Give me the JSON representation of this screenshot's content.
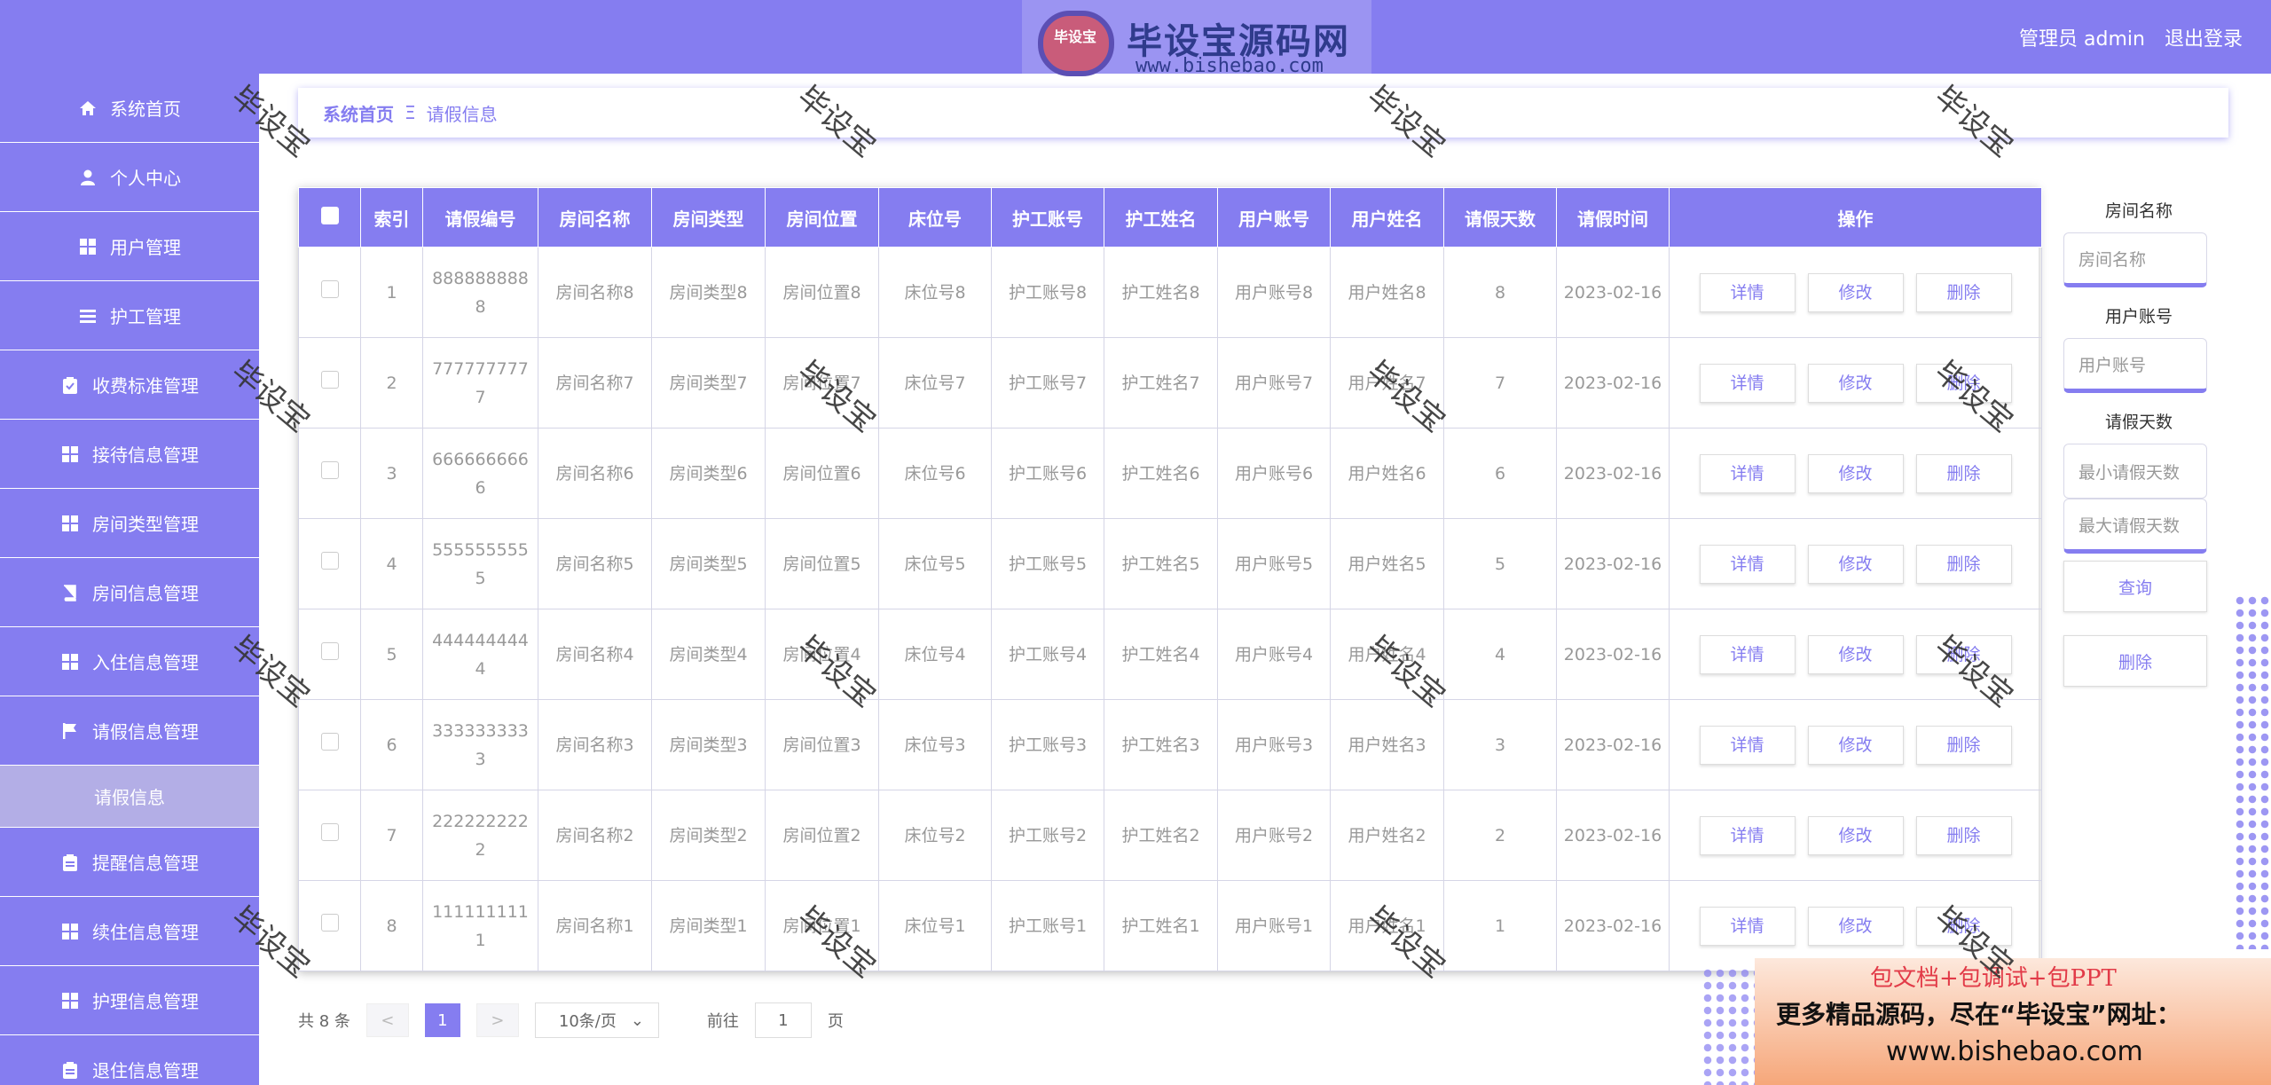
{
  "header": {
    "user_label": "管理员 admin",
    "logout": "退出登录",
    "brand_logo_text": "毕设宝",
    "brand_title": "毕设宝源码网",
    "brand_url": "www.bishebao.com"
  },
  "sidebar": {
    "items": [
      {
        "label": "系统首页",
        "icon": "home-icon"
      },
      {
        "label": "个人中心",
        "icon": "user-icon"
      },
      {
        "label": "用户管理",
        "icon": "grid-icon"
      },
      {
        "label": "护工管理",
        "icon": "list-icon"
      },
      {
        "label": "收费标准管理",
        "icon": "clipboard-check-icon"
      },
      {
        "label": "接待信息管理",
        "icon": "grid-icon"
      },
      {
        "label": "房间类型管理",
        "icon": "grid-icon"
      },
      {
        "label": "房间信息管理",
        "icon": "book-icon"
      },
      {
        "label": "入住信息管理",
        "icon": "grid-icon"
      },
      {
        "label": "请假信息管理",
        "icon": "flag-icon"
      }
    ],
    "active_sub": "请假信息",
    "items_after": [
      {
        "label": "提醒信息管理",
        "icon": "clipboard-icon"
      },
      {
        "label": "续住信息管理",
        "icon": "grid-icon"
      },
      {
        "label": "护理信息管理",
        "icon": "grid-icon"
      },
      {
        "label": "退住信息管理",
        "icon": "clipboard-icon"
      }
    ]
  },
  "breadcrumb": {
    "home": "系统首页",
    "sep": "Ξ",
    "current": "请假信息"
  },
  "table": {
    "headers": [
      "索引",
      "请假编号",
      "房间名称",
      "房间类型",
      "房间位置",
      "床位号",
      "护工账号",
      "护工姓名",
      "用户账号",
      "用户姓名",
      "请假天数",
      "请假时间",
      "操作"
    ],
    "rows": [
      [
        "1",
        "8888888888",
        "房间名称8",
        "房间类型8",
        "房间位置8",
        "床位号8",
        "护工账号8",
        "护工姓名8",
        "用户账号8",
        "用户姓名8",
        "8",
        "2023-02-16"
      ],
      [
        "2",
        "7777777777",
        "房间名称7",
        "房间类型7",
        "房间位置7",
        "床位号7",
        "护工账号7",
        "护工姓名7",
        "用户账号7",
        "用户姓名7",
        "7",
        "2023-02-16"
      ],
      [
        "3",
        "6666666666",
        "房间名称6",
        "房间类型6",
        "房间位置6",
        "床位号6",
        "护工账号6",
        "护工姓名6",
        "用户账号6",
        "用户姓名6",
        "6",
        "2023-02-16"
      ],
      [
        "4",
        "5555555555",
        "房间名称5",
        "房间类型5",
        "房间位置5",
        "床位号5",
        "护工账号5",
        "护工姓名5",
        "用户账号5",
        "用户姓名5",
        "5",
        "2023-02-16"
      ],
      [
        "5",
        "4444444444",
        "房间名称4",
        "房间类型4",
        "房间位置4",
        "床位号4",
        "护工账号4",
        "护工姓名4",
        "用户账号4",
        "用户姓名4",
        "4",
        "2023-02-16"
      ],
      [
        "6",
        "3333333333",
        "房间名称3",
        "房间类型3",
        "房间位置3",
        "床位号3",
        "护工账号3",
        "护工姓名3",
        "用户账号3",
        "用户姓名3",
        "3",
        "2023-02-16"
      ],
      [
        "7",
        "2222222222",
        "房间名称2",
        "房间类型2",
        "房间位置2",
        "床位号2",
        "护工账号2",
        "护工姓名2",
        "用户账号2",
        "用户姓名2",
        "2",
        "2023-02-16"
      ],
      [
        "8",
        "1111111111",
        "房间名称1",
        "房间类型1",
        "房间位置1",
        "床位号1",
        "护工账号1",
        "护工姓名1",
        "用户账号1",
        "用户姓名1",
        "1",
        "2023-02-16"
      ]
    ],
    "actions": {
      "detail": "详情",
      "edit": "修改",
      "delete": "删除"
    }
  },
  "search": {
    "room_label": "房间名称",
    "room_placeholder": "房间名称",
    "user_label": "用户账号",
    "user_placeholder": "用户账号",
    "days_label": "请假天数",
    "days_min_placeholder": "最小请假天数",
    "days_max_placeholder": "最大请假天数",
    "query_btn": "查询",
    "delete_btn": "删除"
  },
  "pager": {
    "total": "共 8 条",
    "prev": "<",
    "current": "1",
    "next": ">",
    "size": "10条/页",
    "goto": "前往",
    "goto_value": "1",
    "page_unit": "页"
  },
  "promo": {
    "line1": "包文档+包调试+包PPT",
    "line2": "更多精品源码，尽在“毕设宝”网址：",
    "line3": "www.bishebao.com"
  },
  "watermark": "毕设宝",
  "colors": {
    "accent": "#857df0",
    "sub_active": "#b3aee6"
  }
}
